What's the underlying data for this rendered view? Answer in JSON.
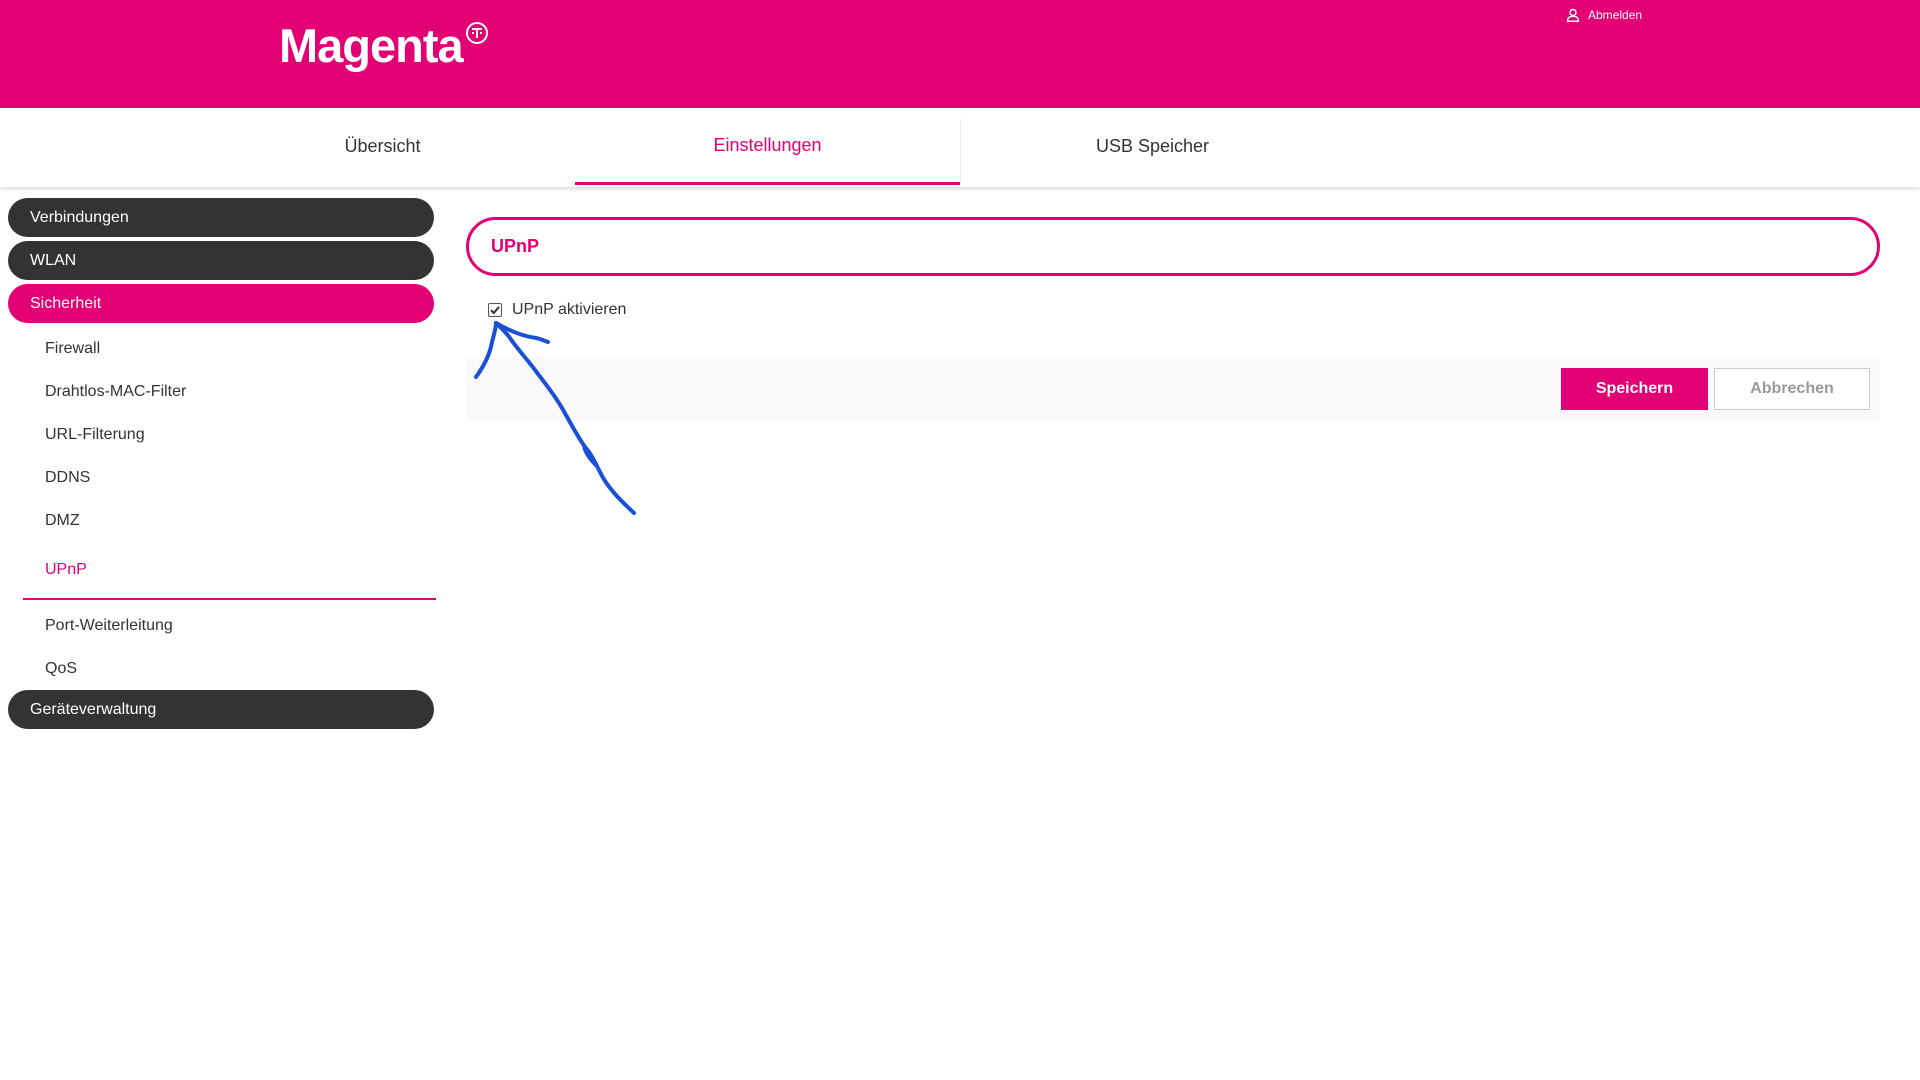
{
  "header": {
    "logo_text": "Magenta",
    "logo_mark_icon": "telekom-t-icon",
    "logout_label": "Abmelden",
    "logout_icon": "user-icon",
    "brand_color": "#e20074"
  },
  "topnav": {
    "tabs": [
      {
        "label": "Übersicht",
        "active": false
      },
      {
        "label": "Einstellungen",
        "active": true
      },
      {
        "label": "USB Speicher",
        "active": false
      }
    ]
  },
  "sidebar": {
    "sections": [
      {
        "label": "Verbindungen",
        "active": false
      },
      {
        "label": "WLAN",
        "active": false
      },
      {
        "label": "Sicherheit",
        "active": true
      },
      {
        "label": "Geräteverwaltung",
        "active": false
      }
    ],
    "sub_items": [
      {
        "label": "Firewall",
        "active": false
      },
      {
        "label": "Drahtlos-MAC-Filter",
        "active": false
      },
      {
        "label": "URL-Filterung",
        "active": false
      },
      {
        "label": "DDNS",
        "active": false
      },
      {
        "label": "DMZ",
        "active": false
      },
      {
        "label": "UPnP",
        "active": true
      },
      {
        "label": "Port-Weiterleitung",
        "active": false
      },
      {
        "label": "QoS",
        "active": false
      }
    ]
  },
  "main": {
    "section_title": "UPnP",
    "upnp_checkbox": {
      "label": "UPnP aktivieren",
      "checked": true
    },
    "save_label": "Speichern",
    "cancel_label": "Abbrechen"
  },
  "annotation": {
    "type": "hand-drawn-arrow",
    "color": "#1a4fd6"
  }
}
